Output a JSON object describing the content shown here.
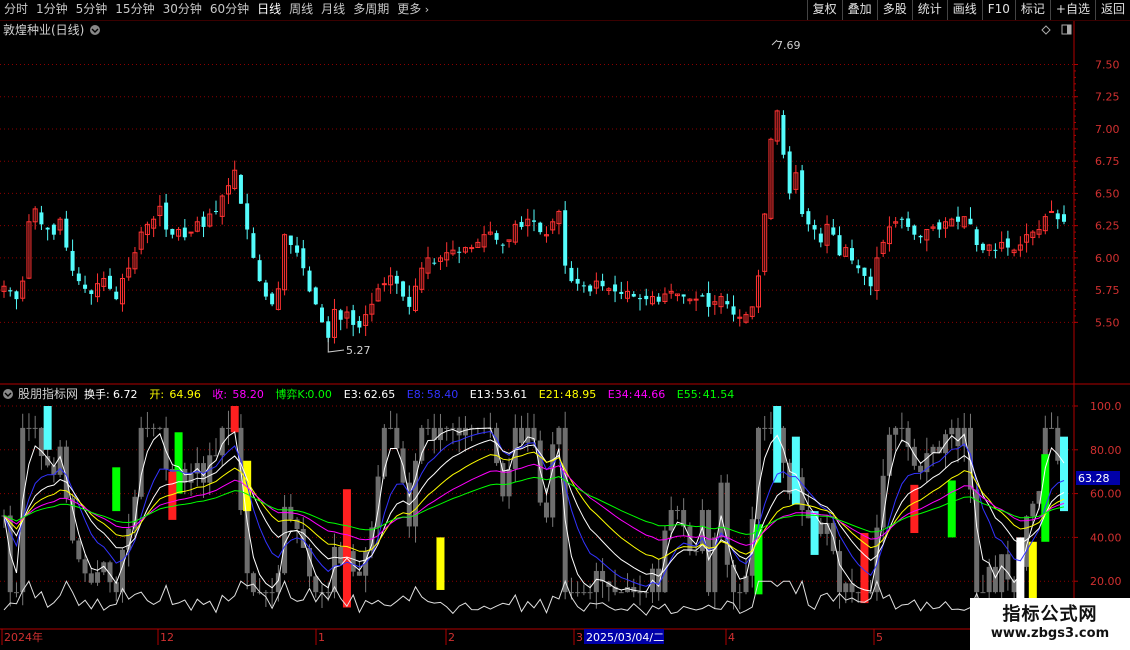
{
  "toolbar": {
    "periods": [
      "分时",
      "1分钟",
      "5分钟",
      "15分钟",
      "30分钟",
      "60分钟",
      "日线",
      "周线",
      "月线",
      "多周期",
      "更多"
    ],
    "active_period": "日线",
    "tools": [
      "复权",
      "叠加",
      "多股",
      "统计",
      "画线",
      "F10",
      "标记",
      "+自选",
      "返回"
    ]
  },
  "main_panel": {
    "title": "敦煌种业(日线)",
    "high_label": "7.69",
    "low_label": "5.27",
    "y_ticks": [
      "7.50",
      "7.25",
      "7.00",
      "6.75",
      "6.50",
      "6.25",
      "6.00",
      "5.75",
      "5.50"
    ],
    "icons": [
      "diamond-icon",
      "panel-toggle-icon",
      "dropdown-icon"
    ]
  },
  "indicator_panel": {
    "name": "股朋指标网",
    "readouts": [
      {
        "label": "换手:",
        "value": "6.72",
        "color": "#ffffff"
      },
      {
        "label": "开:",
        "value": "64.96",
        "color": "#ffff00"
      },
      {
        "label": "收:",
        "value": "58.20",
        "color": "#ff00ff"
      },
      {
        "label": "博弈K:",
        "value": "0.00",
        "color": "#00ff00"
      },
      {
        "label": "E3:",
        "value": "62.65",
        "color": "#ffffff"
      },
      {
        "label": "E8:",
        "value": "58.40",
        "color": "#3333ff"
      },
      {
        "label": "E13:",
        "value": "53.61",
        "color": "#ffffff"
      },
      {
        "label": "E21:",
        "value": "48.95",
        "color": "#ffff00"
      },
      {
        "label": "E34:",
        "value": "44.66",
        "color": "#ff00ff"
      },
      {
        "label": "E55:",
        "value": "41.54",
        "color": "#00ff00"
      }
    ],
    "y_ticks": [
      "100.0",
      "80.00",
      "60.00",
      "40.00",
      "20.00"
    ],
    "current_value": "63.28"
  },
  "time_axis": {
    "labels": [
      "2024年",
      "12",
      "1",
      "2",
      "3",
      "4",
      "5"
    ],
    "cursor_date": "2025/03/04/二"
  },
  "watermark": {
    "title": "指标公式网",
    "url": "www.zbgs3.com"
  },
  "colors": {
    "up": "#ff3232",
    "down": "#54fcfc",
    "grid": "#8b0000",
    "axis": "#b00000",
    "bg": "#000000"
  },
  "chart_data": {
    "type": "candlestick",
    "price_ylim": [
      5.27,
      7.69
    ],
    "closes": [
      5.78,
      5.74,
      5.68,
      5.82,
      6.28,
      6.38,
      6.26,
      6.22,
      6.18,
      6.3,
      6.08,
      5.9,
      5.82,
      5.76,
      5.72,
      5.8,
      5.84,
      5.76,
      5.68,
      5.84,
      5.92,
      6.04,
      6.2,
      6.26,
      6.3,
      6.4,
      6.22,
      6.18,
      6.22,
      6.16,
      6.2,
      6.28,
      6.24,
      6.34,
      6.36,
      6.48,
      6.56,
      6.68,
      6.42,
      6.22,
      6.0,
      5.82,
      5.7,
      5.64,
      5.76,
      6.18,
      6.1,
      6.04,
      5.92,
      5.74,
      5.64,
      5.5,
      5.38,
      5.6,
      5.52,
      5.58,
      5.48,
      5.46,
      5.56,
      5.64,
      5.76,
      5.8,
      5.86,
      5.8,
      5.7,
      5.62,
      5.78,
      5.92,
      6.0,
      5.96,
      6.0,
      6.04,
      6.06,
      6.04,
      6.08,
      6.08,
      6.12,
      6.18,
      6.2,
      6.14,
      6.1,
      6.14,
      6.26,
      6.24,
      6.3,
      6.28,
      6.2,
      6.18,
      6.28,
      6.36,
      5.94,
      5.82,
      5.8,
      5.78,
      5.74,
      5.82,
      5.78,
      5.76,
      5.74,
      5.72,
      5.74,
      5.7,
      5.68,
      5.68,
      5.7,
      5.66,
      5.72,
      5.74,
      5.72,
      5.7,
      5.68,
      5.68,
      5.7,
      5.62,
      5.66,
      5.7,
      5.64,
      5.56,
      5.54,
      5.56,
      5.62,
      5.86,
      6.34,
      6.92,
      7.14,
      6.8,
      6.5,
      6.66,
      6.34,
      6.26,
      6.22,
      6.12,
      6.26,
      6.18,
      6.02,
      6.08,
      5.98,
      5.92,
      5.86,
      5.78,
      6.0,
      6.12,
      6.24,
      6.28,
      6.3,
      6.24,
      6.18,
      6.16,
      6.22,
      6.24,
      6.22,
      6.28,
      6.3,
      6.28,
      6.32,
      6.26,
      6.1,
      6.06,
      6.1,
      6.06,
      6.12,
      6.08,
      6.06,
      6.1,
      6.18,
      6.2,
      6.22,
      6.32,
      6.36,
      6.3,
      6.28
    ],
    "indicator_series": [
      {
        "name": "E3"
      },
      {
        "name": "E8"
      },
      {
        "name": "E13"
      },
      {
        "name": "E21"
      },
      {
        "name": "E34"
      },
      {
        "name": "E55"
      }
    ]
  }
}
